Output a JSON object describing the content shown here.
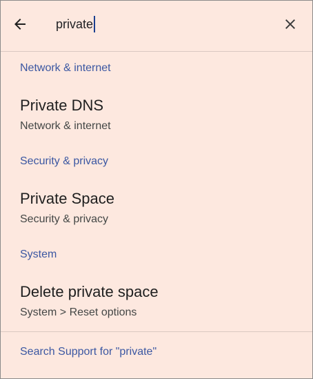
{
  "search": {
    "query": "private",
    "back_icon": "arrow-back-icon",
    "clear_icon": "close-icon"
  },
  "sections": [
    {
      "header": "Network & internet",
      "result": {
        "title": "Private DNS",
        "subtitle": "Network & internet"
      }
    },
    {
      "header": "Security & privacy",
      "result": {
        "title": "Private Space",
        "subtitle": "Security & privacy"
      }
    },
    {
      "header": "System",
      "result": {
        "title": "Delete private space",
        "subtitle": "System > Reset options"
      }
    }
  ],
  "footer": {
    "support_link": "Search Support for \"private\""
  },
  "colors": {
    "background": "#fde8df",
    "accent": "#3b57a2",
    "primary_text": "#1f1f1f",
    "secondary_text": "#444746"
  }
}
